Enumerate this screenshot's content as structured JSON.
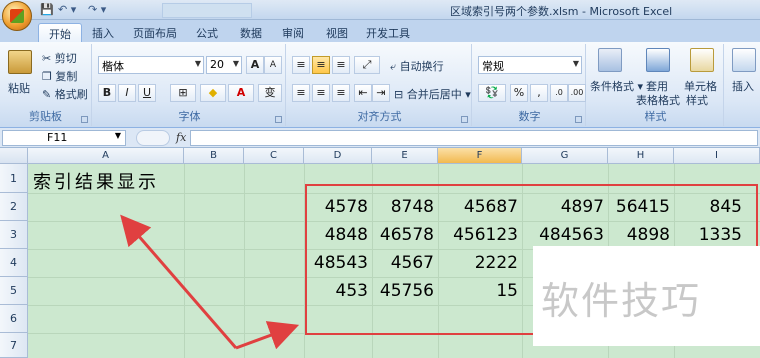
{
  "window": {
    "title": "区域索引号两个参数.xlsm - Microsoft Excel",
    "qat_save": "💾",
    "qat_undo": "↶ ▾",
    "qat_redo": "↷ ▾"
  },
  "tabs": [
    "开始",
    "插入",
    "页面布局",
    "公式",
    "数据",
    "审阅",
    "视图",
    "开发工具"
  ],
  "ribbon": {
    "clipboard": {
      "label": "剪贴板",
      "paste": "粘贴",
      "cut": "剪切",
      "copy": "复制",
      "format_painter": "格式刷"
    },
    "font": {
      "label": "字体",
      "name": "楷体",
      "size": "20",
      "bold": "B",
      "italic": "I",
      "underline": "U",
      "grow": "A",
      "shrink": "A",
      "phonetic": "变"
    },
    "alignment": {
      "label": "对齐方式",
      "wrap": "自动换行",
      "merge": "合并后居中"
    },
    "number": {
      "label": "数字",
      "format": "常规",
      "percent": "%",
      "comma": ","
    },
    "styles": {
      "label": "样式",
      "conditional": "条件格式",
      "table": "套用",
      "table2": "表格格式",
      "cell": "单元格",
      "cell2": "样式"
    },
    "cells": {
      "insert": "插入"
    }
  },
  "formula_bar": {
    "name_box": "F11",
    "fx": "fx",
    "value": ""
  },
  "columns": [
    "A",
    "B",
    "C",
    "D",
    "E",
    "F",
    "G",
    "H",
    "I"
  ],
  "selected_column": "F",
  "rows": [
    "1",
    "2",
    "3",
    "4",
    "5",
    "6",
    "7"
  ],
  "cells": {
    "A1": "索引结果显示",
    "D2": "4578",
    "E2": "8748",
    "F2": "45687",
    "G2": "4897",
    "H2": "56415",
    "I2": "845",
    "D3": "4848",
    "E3": "46578",
    "F3": "456123",
    "G3": "484563",
    "H3": "4898",
    "I3": "1335",
    "D4": "48543",
    "E4": "4567",
    "F4": "2222",
    "D5": "453",
    "E5": "45756",
    "F5": "15"
  },
  "watermark": "软件技巧",
  "colors": {
    "grid_bg": "#cce8cf",
    "annotation": "#e04040",
    "selected_header": "#f2b94f"
  }
}
